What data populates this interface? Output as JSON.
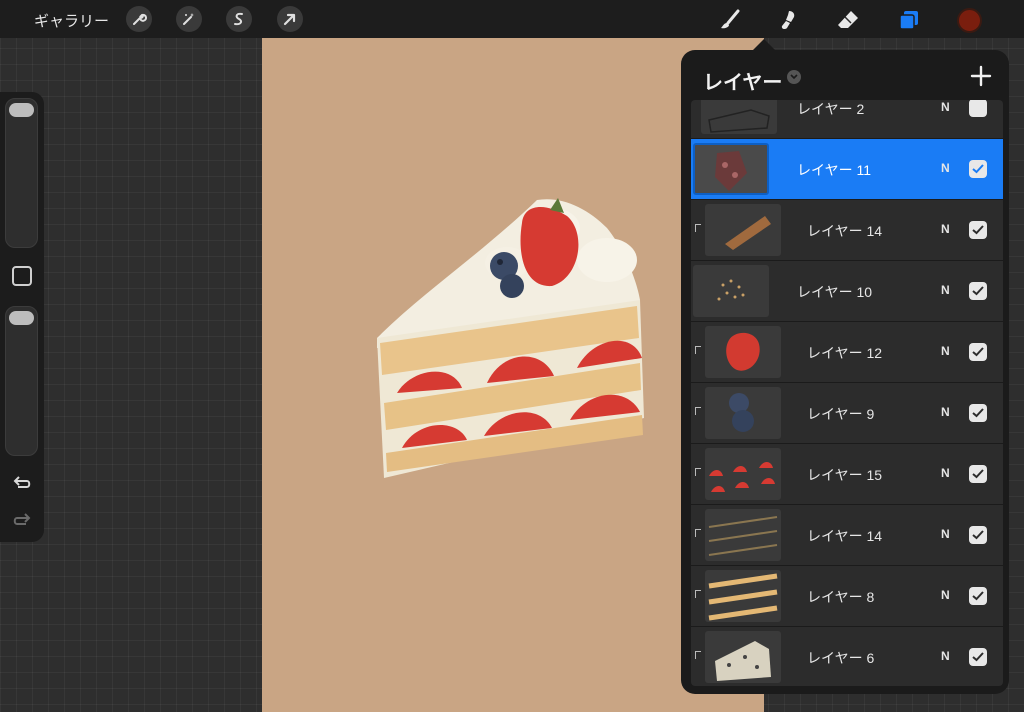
{
  "topbar": {
    "gallery_label": "ギャラリー",
    "left_tools": [
      "wrench-icon",
      "magic-wand-icon",
      "selection-s-icon",
      "transform-arrow-icon"
    ],
    "right_tools": [
      "brush-icon",
      "smudge-icon",
      "eraser-icon",
      "layers-icon"
    ],
    "active_tool": "layers-icon",
    "current_color": "#7a1e0e"
  },
  "sidebar": {
    "controls": [
      "brush-size-slider",
      "modify-button",
      "opacity-slider",
      "undo-icon",
      "redo-icon"
    ]
  },
  "canvas": {
    "background_color": "#c9a584",
    "artwork": "strawberry shortcake slice"
  },
  "layers_panel": {
    "title": "レイヤー",
    "add_icon": "plus-icon",
    "layers": [
      {
        "name": "レイヤー 2",
        "blend": "N",
        "visible": true,
        "selected": false,
        "clipped": false
      },
      {
        "name": "レイヤー 11",
        "blend": "N",
        "visible": true,
        "selected": true,
        "clipped": false
      },
      {
        "name": "レイヤー 14",
        "blend": "N",
        "visible": true,
        "selected": false,
        "clipped": true
      },
      {
        "name": "レイヤー 10",
        "blend": "N",
        "visible": true,
        "selected": false,
        "clipped": false
      },
      {
        "name": "レイヤー 12",
        "blend": "N",
        "visible": true,
        "selected": false,
        "clipped": true
      },
      {
        "name": "レイヤー 9",
        "blend": "N",
        "visible": true,
        "selected": false,
        "clipped": true
      },
      {
        "name": "レイヤー 15",
        "blend": "N",
        "visible": true,
        "selected": false,
        "clipped": true
      },
      {
        "name": "レイヤー 14",
        "blend": "N",
        "visible": true,
        "selected": false,
        "clipped": true
      },
      {
        "name": "レイヤー 8",
        "blend": "N",
        "visible": true,
        "selected": false,
        "clipped": true
      },
      {
        "name": "レイヤー 6",
        "blend": "N",
        "visible": true,
        "selected": false,
        "clipped": true
      }
    ]
  }
}
